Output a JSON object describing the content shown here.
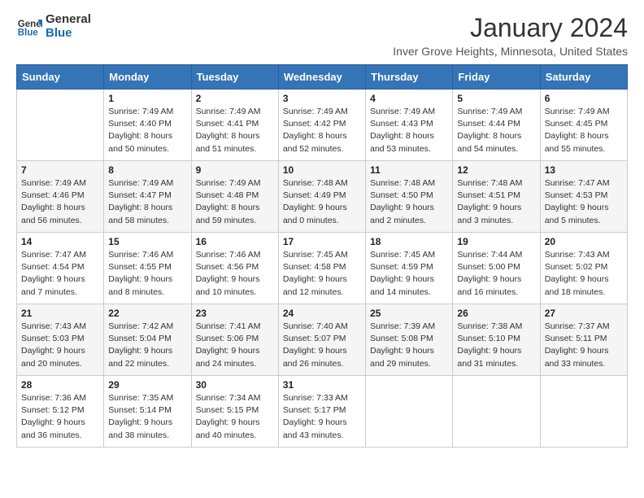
{
  "header": {
    "logo_general": "General",
    "logo_blue": "Blue",
    "month_title": "January 2024",
    "location": "Inver Grove Heights, Minnesota, United States"
  },
  "days_of_week": [
    "Sunday",
    "Monday",
    "Tuesday",
    "Wednesday",
    "Thursday",
    "Friday",
    "Saturday"
  ],
  "weeks": [
    [
      {
        "day": "",
        "info": ""
      },
      {
        "day": "1",
        "info": "Sunrise: 7:49 AM\nSunset: 4:40 PM\nDaylight: 8 hours\nand 50 minutes."
      },
      {
        "day": "2",
        "info": "Sunrise: 7:49 AM\nSunset: 4:41 PM\nDaylight: 8 hours\nand 51 minutes."
      },
      {
        "day": "3",
        "info": "Sunrise: 7:49 AM\nSunset: 4:42 PM\nDaylight: 8 hours\nand 52 minutes."
      },
      {
        "day": "4",
        "info": "Sunrise: 7:49 AM\nSunset: 4:43 PM\nDaylight: 8 hours\nand 53 minutes."
      },
      {
        "day": "5",
        "info": "Sunrise: 7:49 AM\nSunset: 4:44 PM\nDaylight: 8 hours\nand 54 minutes."
      },
      {
        "day": "6",
        "info": "Sunrise: 7:49 AM\nSunset: 4:45 PM\nDaylight: 8 hours\nand 55 minutes."
      }
    ],
    [
      {
        "day": "7",
        "info": "Sunrise: 7:49 AM\nSunset: 4:46 PM\nDaylight: 8 hours\nand 56 minutes."
      },
      {
        "day": "8",
        "info": "Sunrise: 7:49 AM\nSunset: 4:47 PM\nDaylight: 8 hours\nand 58 minutes."
      },
      {
        "day": "9",
        "info": "Sunrise: 7:49 AM\nSunset: 4:48 PM\nDaylight: 8 hours\nand 59 minutes."
      },
      {
        "day": "10",
        "info": "Sunrise: 7:48 AM\nSunset: 4:49 PM\nDaylight: 9 hours\nand 0 minutes."
      },
      {
        "day": "11",
        "info": "Sunrise: 7:48 AM\nSunset: 4:50 PM\nDaylight: 9 hours\nand 2 minutes."
      },
      {
        "day": "12",
        "info": "Sunrise: 7:48 AM\nSunset: 4:51 PM\nDaylight: 9 hours\nand 3 minutes."
      },
      {
        "day": "13",
        "info": "Sunrise: 7:47 AM\nSunset: 4:53 PM\nDaylight: 9 hours\nand 5 minutes."
      }
    ],
    [
      {
        "day": "14",
        "info": "Sunrise: 7:47 AM\nSunset: 4:54 PM\nDaylight: 9 hours\nand 7 minutes."
      },
      {
        "day": "15",
        "info": "Sunrise: 7:46 AM\nSunset: 4:55 PM\nDaylight: 9 hours\nand 8 minutes."
      },
      {
        "day": "16",
        "info": "Sunrise: 7:46 AM\nSunset: 4:56 PM\nDaylight: 9 hours\nand 10 minutes."
      },
      {
        "day": "17",
        "info": "Sunrise: 7:45 AM\nSunset: 4:58 PM\nDaylight: 9 hours\nand 12 minutes."
      },
      {
        "day": "18",
        "info": "Sunrise: 7:45 AM\nSunset: 4:59 PM\nDaylight: 9 hours\nand 14 minutes."
      },
      {
        "day": "19",
        "info": "Sunrise: 7:44 AM\nSunset: 5:00 PM\nDaylight: 9 hours\nand 16 minutes."
      },
      {
        "day": "20",
        "info": "Sunrise: 7:43 AM\nSunset: 5:02 PM\nDaylight: 9 hours\nand 18 minutes."
      }
    ],
    [
      {
        "day": "21",
        "info": "Sunrise: 7:43 AM\nSunset: 5:03 PM\nDaylight: 9 hours\nand 20 minutes."
      },
      {
        "day": "22",
        "info": "Sunrise: 7:42 AM\nSunset: 5:04 PM\nDaylight: 9 hours\nand 22 minutes."
      },
      {
        "day": "23",
        "info": "Sunrise: 7:41 AM\nSunset: 5:06 PM\nDaylight: 9 hours\nand 24 minutes."
      },
      {
        "day": "24",
        "info": "Sunrise: 7:40 AM\nSunset: 5:07 PM\nDaylight: 9 hours\nand 26 minutes."
      },
      {
        "day": "25",
        "info": "Sunrise: 7:39 AM\nSunset: 5:08 PM\nDaylight: 9 hours\nand 29 minutes."
      },
      {
        "day": "26",
        "info": "Sunrise: 7:38 AM\nSunset: 5:10 PM\nDaylight: 9 hours\nand 31 minutes."
      },
      {
        "day": "27",
        "info": "Sunrise: 7:37 AM\nSunset: 5:11 PM\nDaylight: 9 hours\nand 33 minutes."
      }
    ],
    [
      {
        "day": "28",
        "info": "Sunrise: 7:36 AM\nSunset: 5:12 PM\nDaylight: 9 hours\nand 36 minutes."
      },
      {
        "day": "29",
        "info": "Sunrise: 7:35 AM\nSunset: 5:14 PM\nDaylight: 9 hours\nand 38 minutes."
      },
      {
        "day": "30",
        "info": "Sunrise: 7:34 AM\nSunset: 5:15 PM\nDaylight: 9 hours\nand 40 minutes."
      },
      {
        "day": "31",
        "info": "Sunrise: 7:33 AM\nSunset: 5:17 PM\nDaylight: 9 hours\nand 43 minutes."
      },
      {
        "day": "",
        "info": ""
      },
      {
        "day": "",
        "info": ""
      },
      {
        "day": "",
        "info": ""
      }
    ]
  ]
}
